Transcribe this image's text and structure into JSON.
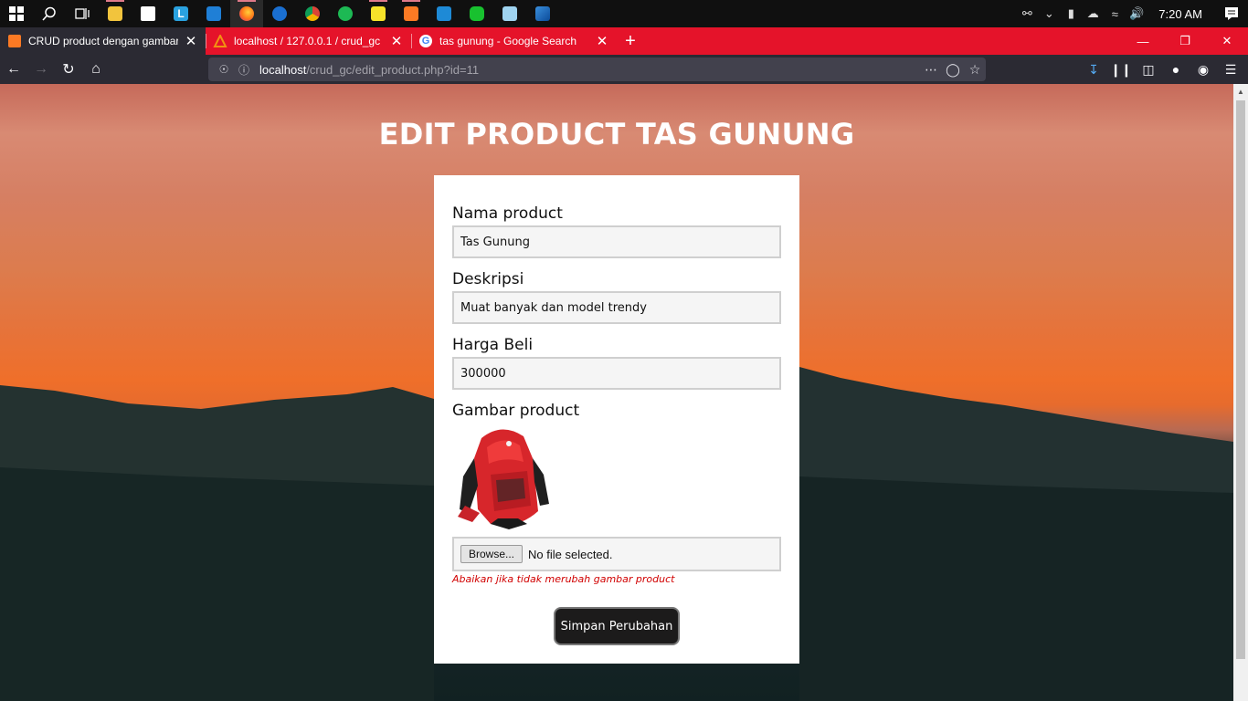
{
  "taskbar": {
    "clock": "7:20 AM",
    "icons": [
      "windows-start",
      "search",
      "task-view",
      "file-explorer",
      "store",
      "app-l",
      "mail",
      "firefox",
      "edge",
      "chrome",
      "spotify",
      "sticky-notes",
      "xampp",
      "vscode",
      "line",
      "notepad",
      "photos"
    ]
  },
  "browser": {
    "tabs": [
      {
        "title": "CRUD product dengan gambar",
        "icon": "xampp-icon",
        "active": true
      },
      {
        "title": "localhost / 127.0.0.1 / crud_gc |",
        "icon": "phpmyadmin-icon",
        "active": false
      },
      {
        "title": "tas gunung - Google Search",
        "icon": "google-icon",
        "active": false
      }
    ],
    "url_host": "localhost",
    "url_path": "/crud_gc/edit_product.php?id=11"
  },
  "page": {
    "title": "EDIT PRODUCT TAS GUNUNG",
    "form": {
      "nama_label": "Nama product",
      "nama_value": "Tas Gunung",
      "deskripsi_label": "Deskripsi",
      "deskripsi_value": "Muat banyak dan model trendy",
      "harga_label": "Harga Beli",
      "harga_value": "300000",
      "gambar_label": "Gambar product",
      "browse_label": "Browse...",
      "no_file": "No file selected.",
      "hint": "Abaikan jika tidak merubah gambar product",
      "submit_label": "Simpan Perubahan"
    }
  },
  "colors": {
    "tabstrip": "#e5132a",
    "toolbar": "#2b2a33",
    "hint": "#d10000",
    "button": "#1c1b1b"
  }
}
